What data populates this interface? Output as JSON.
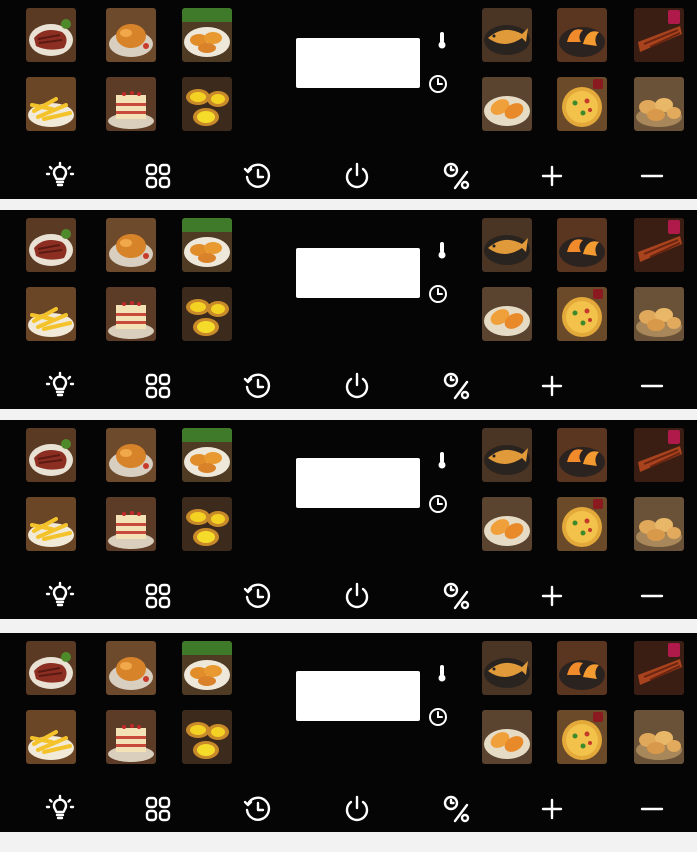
{
  "colors": {
    "panel_background": "#050505",
    "page_background": "#f2f2f2",
    "display": "#ffffff",
    "icon": "#ffffff"
  },
  "panels_count": 4,
  "food_tiles": [
    {
      "name": "steak-tile",
      "icon": "steak"
    },
    {
      "name": "roast-chicken-tile",
      "icon": "roast-chicken"
    },
    {
      "name": "chicken-wings-tile",
      "icon": "chicken-wings"
    },
    {
      "name": "french-fries-tile",
      "icon": "french-fries"
    },
    {
      "name": "cake-tile",
      "icon": "cake"
    },
    {
      "name": "egg-tarts-tile",
      "icon": "egg-tarts"
    },
    {
      "name": "fish-tile",
      "icon": "fish"
    },
    {
      "name": "shrimp-tile",
      "icon": "shrimp"
    },
    {
      "name": "ribs-tile",
      "icon": "ribs"
    },
    {
      "name": "sweet-potato-tile",
      "icon": "sweet-potato"
    },
    {
      "name": "pizza-tile",
      "icon": "pizza"
    },
    {
      "name": "bread-tile",
      "icon": "bread"
    }
  ],
  "indicators": [
    "thermometer-icon",
    "clock-icon"
  ],
  "controls": [
    {
      "name": "light-button",
      "icon": "light-bulb-icon"
    },
    {
      "name": "menu-button",
      "icon": "grid-icon"
    },
    {
      "name": "timer-button",
      "icon": "timer-icon"
    },
    {
      "name": "power-button",
      "icon": "power-icon"
    },
    {
      "name": "time-temperature-button",
      "icon": "time-percent-icon"
    },
    {
      "name": "plus-button",
      "icon": "plus-icon"
    },
    {
      "name": "minus-button",
      "icon": "minus-icon"
    }
  ]
}
